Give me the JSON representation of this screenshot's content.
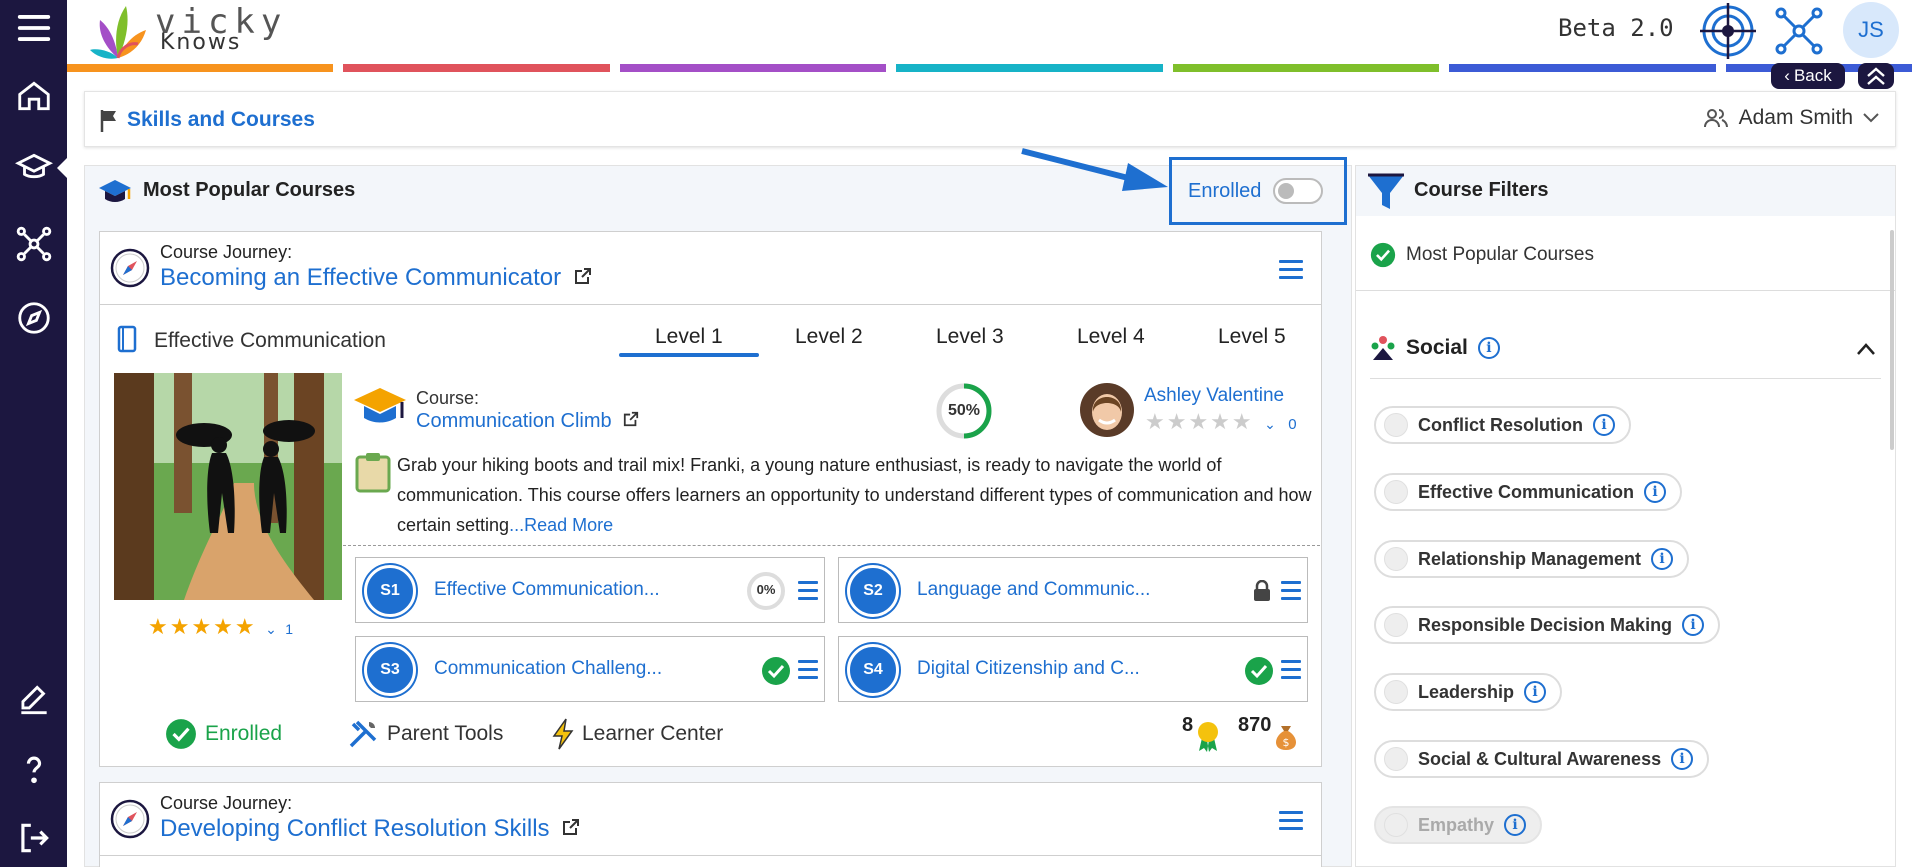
{
  "app": {
    "logo_line1": "vicky",
    "logo_line2": "Knows",
    "beta_label": "Beta 2.0",
    "avatar_initials": "JS"
  },
  "nav": {
    "back_label": "Back"
  },
  "breadcrumb": {
    "title": "Skills and Courses",
    "user_name": "Adam Smith"
  },
  "main": {
    "title": "Most Popular Courses",
    "enrolled_toggle_label": "Enrolled"
  },
  "journeys": [
    {
      "label": "Course Journey:",
      "title": "Becoming an Effective Communicator",
      "skill": "Effective Communication",
      "levels": [
        "Level 1",
        "Level 2",
        "Level 3",
        "Level 4",
        "Level 5"
      ],
      "active_level": "Level 1",
      "course_label": "Course:",
      "course_title": "Communication Climb",
      "progress": "50%",
      "author": "Ashley Valentine",
      "author_rating_count": "0",
      "description": "Grab your hiking boots and trail mix! Franki, a young nature enthusiast, is ready to navigate the world of communication. This course offers learners an opportunity to understand different types of communication and how certain setting",
      "read_more": "...Read More",
      "rating_count": "1",
      "lessons": [
        {
          "num": "S1",
          "title": "Effective Communication...",
          "status": "0%"
        },
        {
          "num": "S2",
          "title": "Language and Communic...",
          "status": "locked"
        },
        {
          "num": "S3",
          "title": "Communication Challeng...",
          "status": "complete"
        },
        {
          "num": "S4",
          "title": "Digital Citizenship and C...",
          "status": "complete"
        }
      ],
      "enrolled_label": "Enrolled",
      "parent_tools": "Parent Tools",
      "learner_center": "Learner Center",
      "badges": "8",
      "points": "870"
    },
    {
      "label": "Course Journey:",
      "title": "Developing Conflict Resolution Skills"
    }
  ],
  "filters": {
    "title": "Course Filters",
    "active_filter": "Most Popular Courses",
    "category": "Social",
    "options": [
      "Conflict Resolution",
      "Effective Communication",
      "Relationship Management",
      "Responsible Decision Making",
      "Leadership",
      "Social & Cultural Awareness",
      "Empathy"
    ]
  },
  "colors": {
    "sidebar": "#1c1740",
    "accent": "#1e6fd0",
    "success": "#1aa34a",
    "stripe": [
      "#f7931e",
      "#e0535c",
      "#a44fc7",
      "#17b3c7",
      "#7fbf2b",
      "#3c5bd6"
    ]
  }
}
